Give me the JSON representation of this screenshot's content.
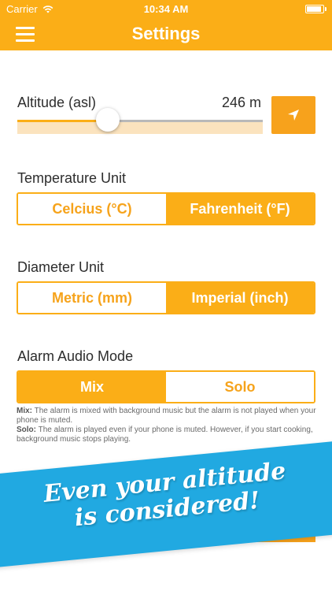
{
  "status_bar": {
    "carrier": "Carrier",
    "time": "10:34 AM"
  },
  "nav": {
    "title": "Settings"
  },
  "altitude": {
    "label": "Altitude (asl)",
    "value": "246 m",
    "slider_fraction": 0.37
  },
  "temperature": {
    "label": "Temperature Unit",
    "options": [
      "Celcius (°C)",
      "Fahrenheit (°F)"
    ],
    "selected": 1
  },
  "diameter": {
    "label": "Diameter Unit",
    "options": [
      "Metric (mm)",
      "Imperial (inch)"
    ],
    "selected": 1
  },
  "alarm": {
    "label": "Alarm Audio Mode",
    "options": [
      "Mix",
      "Solo"
    ],
    "selected": 0,
    "help_mix_title": "Mix:",
    "help_mix_text": " The alarm is mixed with background music but the alarm is not played when your phone is muted.",
    "help_solo_title": "Solo:",
    "help_solo_text": " The alarm is played even if your phone is muted. However, if you start cooking, background music stops playing."
  },
  "banner": {
    "line1": "Even your altitude",
    "line2": "is considered!"
  },
  "colors": {
    "accent": "#FBAE17",
    "banner": "#21A9E1",
    "track_bg": "#FBE3BE"
  },
  "icons": {
    "menu": "hamburger-menu-icon",
    "locate": "location-arrow-icon",
    "wifi": "wifi-icon",
    "battery": "battery-icon"
  }
}
